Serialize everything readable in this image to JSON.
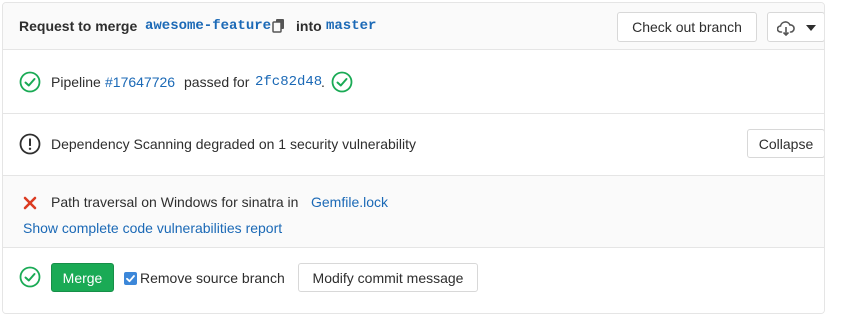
{
  "header": {
    "prefix": "Request to merge",
    "source_branch": "awesome-feature",
    "into": "into",
    "target_branch": "master",
    "checkout_label": "Check out branch"
  },
  "pipeline": {
    "text_pipeline": "Pipeline",
    "pipeline_id": "#17647726",
    "passed_for": "passed for",
    "commit_sha": "2fc82d48",
    "period": "."
  },
  "security": {
    "message": "Dependency Scanning degraded on 1 security vulnerability",
    "collapse_label": "Collapse"
  },
  "vulnerabilities": {
    "items": [
      {
        "text": "Path traversal on Windows for sinatra in",
        "file": "Gemfile.lock"
      }
    ],
    "report_link": "Show complete code vulnerabilities report"
  },
  "merge": {
    "merge_label": "Merge",
    "remove_source_label": "Remove source branch",
    "remove_source_checked": true,
    "modify_commit_label": "Modify commit message"
  },
  "colors": {
    "success": "#1aaa55",
    "danger": "#db3b21",
    "link": "#1b69b6",
    "checkbox": "#3c87d9"
  }
}
